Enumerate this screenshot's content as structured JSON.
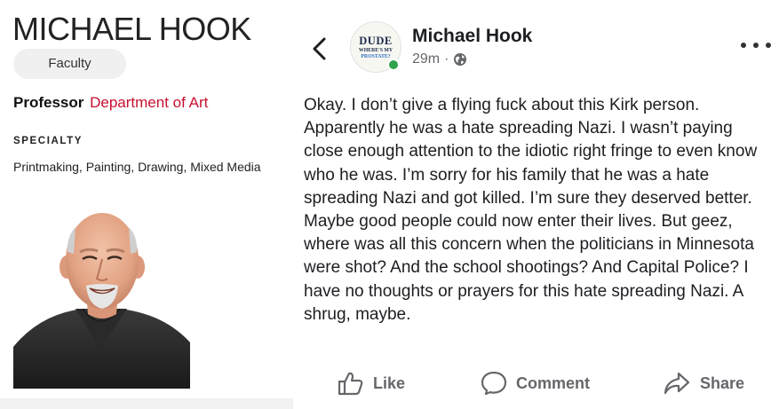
{
  "profile": {
    "name": "MICHAEL HOOK",
    "badge": "Faculty",
    "rank": "Professor",
    "department": "Department of Art",
    "specialty_heading": "SPECIALTY",
    "specialty": "Printmaking, Painting, Drawing, Mixed Media",
    "colors": {
      "department": "#c8102e",
      "badge_bg": "#f0f0f0"
    }
  },
  "post": {
    "author": "Michael Hook",
    "time": "29m",
    "separator": "·",
    "audience_icon": "globe-icon",
    "avatar": {
      "line1": "DUDE",
      "line2": "WHERE'S MY",
      "line3": "PROSTATE?"
    },
    "body": "Okay. I don’t give a flying fuck about this Kirk person. Apparently he was a hate spreading Nazi. I wasn’t paying close enough attention to the idiotic right fringe to even know who he was. I’m sorry for his family that he was a hate spreading Nazi and got killed. I’m sure they deserved better. Maybe good people could now enter their lives. But geez, where was all this concern when the politicians in Minnesota were shot?  And the school shootings? And Capital Police? I have no thoughts or prayers for this hate spreading Nazi. A shrug, maybe.",
    "actions": {
      "like": "Like",
      "comment": "Comment",
      "share": "Share"
    },
    "icons": {
      "back": "chevron-left-icon",
      "more": "more-horizontal-icon",
      "like": "thumbs-up-icon",
      "comment": "comment-bubble-icon",
      "share": "share-arrow-icon"
    },
    "colors": {
      "online": "#31a24c",
      "muted": "#65676b"
    }
  }
}
